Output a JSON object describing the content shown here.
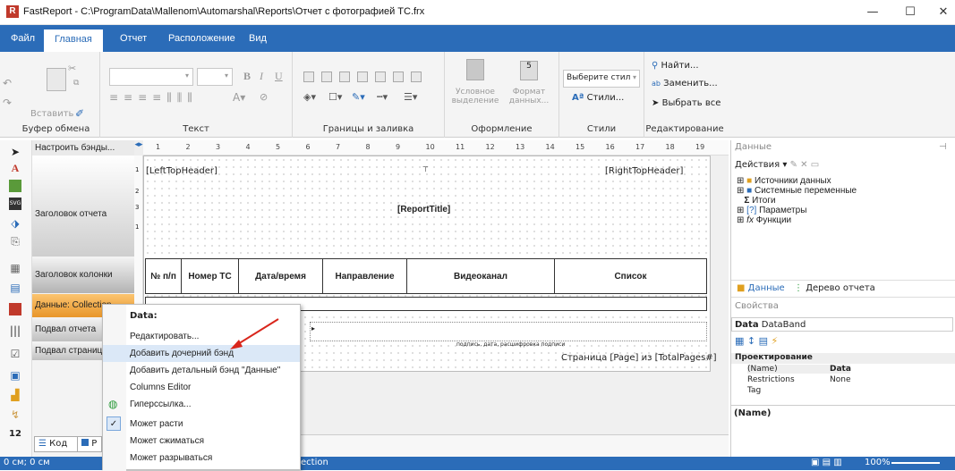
{
  "window": {
    "title": "FastReport - C:\\ProgramData\\Mallenom\\Automarshal\\Reports\\Отчет с фотографией ТС.frx",
    "app_icon": "R",
    "min": "—",
    "max": "☐",
    "close": "✕"
  },
  "menu": {
    "tabs": [
      "Файл",
      "Главная",
      "Отчет",
      "Расположение",
      "Вид"
    ],
    "active": 1
  },
  "ribbon": {
    "clipboard": {
      "paste": "Вставить",
      "label": "Буфер обмена"
    },
    "text": {
      "bold": "B",
      "italic": "I",
      "underline": "U",
      "label": "Текст"
    },
    "borders": {
      "label": "Границы и заливка"
    },
    "format": {
      "conditional": "Условное выделение",
      "data_format": "Формат данных...",
      "label": "Оформление"
    },
    "styles": {
      "select": "Выберите стил",
      "styles_btn": "Стили...",
      "label": "Стили"
    },
    "editing": {
      "find": "Найти...",
      "replace": "Заменить...",
      "select_all": "Выбрать все",
      "label": "Редактирование"
    }
  },
  "bands_toolbar": {
    "configure": "Настроить бэнды..."
  },
  "bands": [
    "Заголовок отчета",
    "Заголовок колонки",
    "Данные: Collection",
    "Подвал отчета",
    "Подвал страницы"
  ],
  "ruler": [
    "1",
    "2",
    "3",
    "4",
    "5",
    "6",
    "7",
    "8",
    "9",
    "10",
    "11",
    "12",
    "13",
    "14",
    "15",
    "16",
    "17",
    "18",
    "19"
  ],
  "vruler": [
    "1",
    "2",
    "3",
    "1"
  ],
  "report": {
    "left_top": "[LeftTopHeader]",
    "right_top": "[RightTopHeader]",
    "title": "[ReportTitle]",
    "columns": [
      "№ п/п",
      "Номер ТС",
      "Дата/время",
      "Направление",
      "Видеоканал",
      "Список"
    ],
    "signature": "подпись, дата, расшифровка подписи",
    "page_footer": "Страница [Page] из [TotalPages#]"
  },
  "bottom_tabs": {
    "code": "Код",
    "page": "P"
  },
  "data_panel": {
    "title": "Данные",
    "actions": "Действия",
    "tree": [
      "Источники данных",
      "Системные переменные",
      "Итоги",
      "Параметры",
      "Функции"
    ],
    "tabs": [
      "Данные",
      "Дерево отчета"
    ]
  },
  "props_panel": {
    "title": "Свойства",
    "object": "Data",
    "object_type": "DataBand",
    "category": "Проектирование",
    "rows": [
      {
        "k": "(Name)",
        "v": "Data"
      },
      {
        "k": "Restrictions",
        "v": "None"
      },
      {
        "k": "Tag",
        "v": ""
      }
    ],
    "desc": "(Name)"
  },
  "context_menu": {
    "header": "Data:",
    "items": [
      "Редактировать...",
      "Добавить дочерний бэнд",
      "Добавить детальный бэнд \"Данные\"",
      "Columns Editor",
      "Гиперссылка...",
      "Может расти",
      "Может сжиматься",
      "Может разрываться"
    ],
    "checked": [
      5
    ],
    "highlighted": 1
  },
  "status": {
    "coords": "0 см; 0 см",
    "selection": "ection",
    "zoom": "100%"
  },
  "colors": {
    "accent": "#2b6cb8",
    "arrow": "#d9261c",
    "band_selected": "#f2a93b"
  }
}
